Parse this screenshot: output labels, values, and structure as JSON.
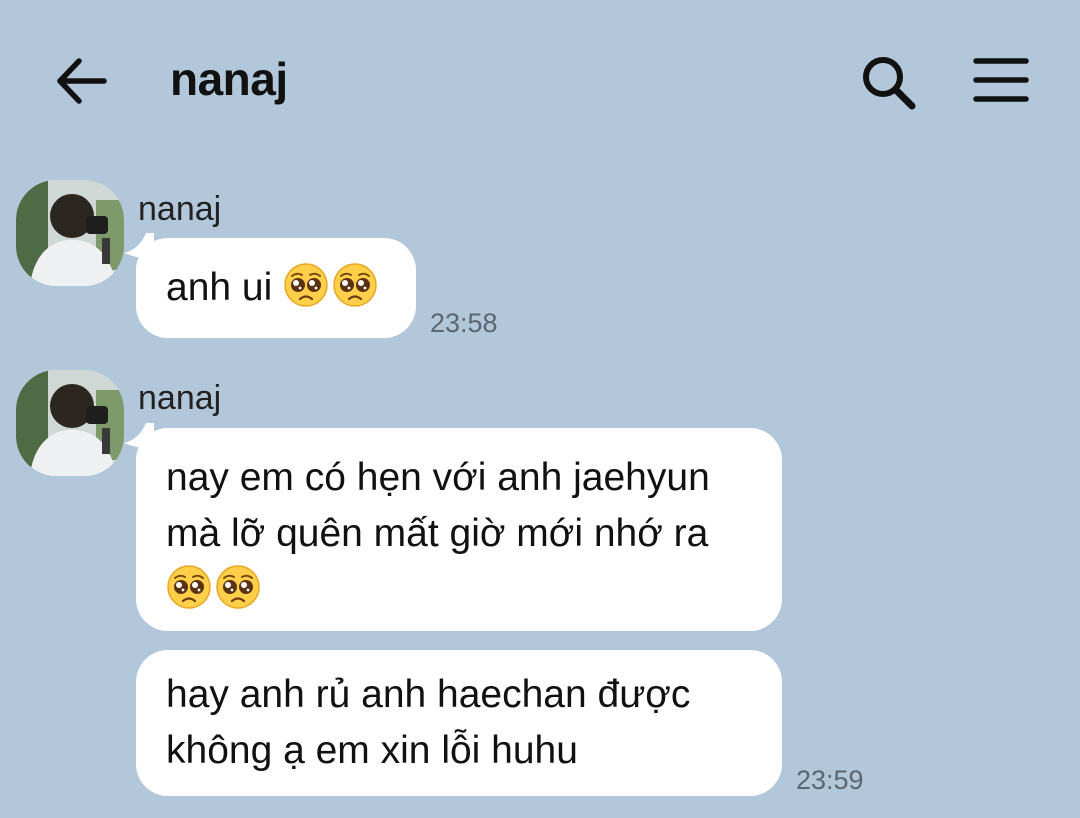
{
  "header": {
    "title": "nanaj",
    "back_icon": "arrow-left-icon",
    "search_icon": "search-icon",
    "menu_icon": "hamburger-menu-icon"
  },
  "messages": [
    {
      "sender": "nanaj",
      "bubbles": [
        {
          "lines": [
            "anh ui 🥺🥺"
          ]
        }
      ],
      "time": "23:58"
    },
    {
      "sender": "nanaj",
      "bubbles": [
        {
          "lines": [
            "nay em có hẹn với anh jaehyun",
            "mà lỡ quên mất giờ mới nhớ ra",
            "🥺🥺"
          ]
        },
        {
          "lines": [
            "hay anh rủ anh haechan được",
            "không ạ em xin lỗi huhu"
          ]
        }
      ],
      "time": "23:59"
    }
  ],
  "colors": {
    "background": "#b2c7da",
    "bubble": "#ffffff",
    "timestamp": "#5c6670"
  }
}
